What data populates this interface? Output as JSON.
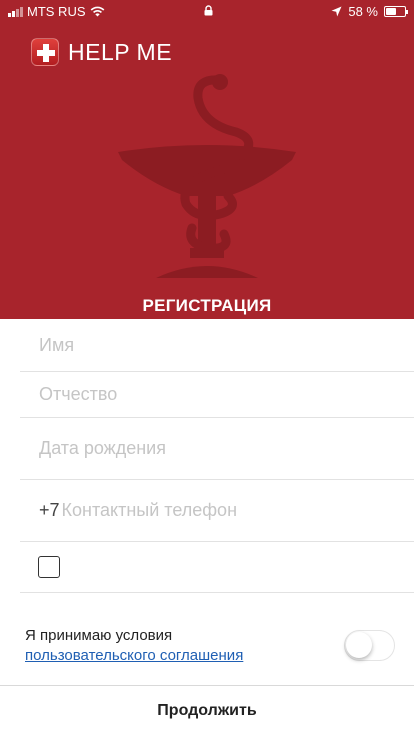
{
  "status_bar": {
    "carrier": "MTS RUS",
    "battery_text": "58 %",
    "battery_level": 0.58
  },
  "app": {
    "title": "HELP ME",
    "section_title": "РЕГИСТРАЦИЯ",
    "brand_color": "#a8242c"
  },
  "form": {
    "name_placeholder": "Имя",
    "patronymic_placeholder": "Отчество",
    "birthdate_placeholder": "Дата рождения",
    "phone_prefix": "+7",
    "phone_placeholder": "Контактный телефон",
    "checkbox_checked": false
  },
  "terms": {
    "text": "Я принимаю условия",
    "link_text": "пользовательского соглашения",
    "accepted": false
  },
  "footer": {
    "continue_label": "Продолжить"
  },
  "icons": {
    "logo": "medical-cross-icon",
    "emblem": "bowl-of-hygieia-icon",
    "wifi": "wifi-icon",
    "lock": "lock-icon",
    "location": "location-arrow-icon",
    "battery": "battery-icon"
  }
}
